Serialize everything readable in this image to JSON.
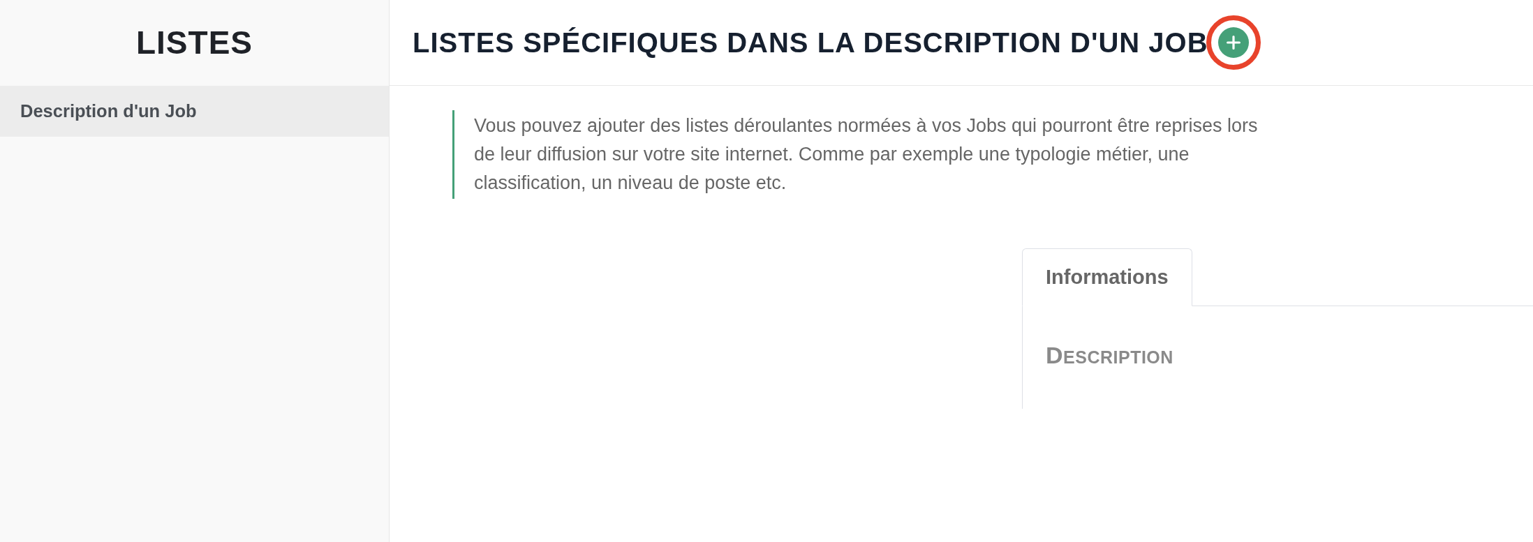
{
  "sidebar": {
    "title": "LISTES",
    "items": [
      {
        "label": "Description d'un Job",
        "selected": true
      }
    ]
  },
  "header": {
    "title": "LISTES SPÉCIFIQUES DANS LA DESCRIPTION D'UN JOB",
    "add_button": {
      "circled": true
    }
  },
  "intro": {
    "text": "Vous pouvez ajouter des listes déroulantes normées à vos Jobs qui pourront être reprises lors de leur diffusion sur votre site internet. Comme par exemple une typologie métier, une classification, un niveau de poste etc."
  },
  "panel": {
    "tabs": [
      {
        "label": "Informations",
        "selected": true
      }
    ],
    "section_title": "DESCRIPTION"
  }
}
